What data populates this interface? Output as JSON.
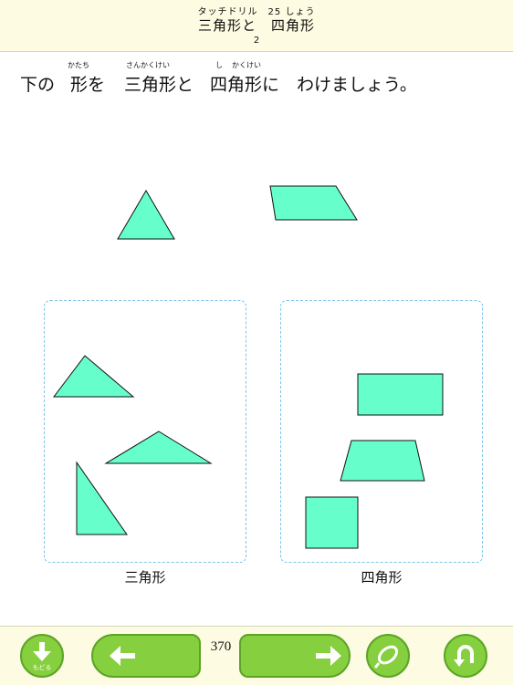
{
  "header": {
    "subtitle": "タッチドリル　25 しょう",
    "title": "三角形と　四角形",
    "page": "2"
  },
  "instruction": {
    "part1": "下の",
    "part2": "形を",
    "part3": "三角形と",
    "part4": "四角形に",
    "part5": "わけましょう。",
    "ruby_katachi": "かたち",
    "ruby_sankakukei": "さんかくけい",
    "ruby_shi": "し",
    "ruby_kakukei": "かくけい"
  },
  "boxes": {
    "triangle_label": "三角形",
    "quad_label": "四角形"
  },
  "footer": {
    "back_label": "もどる",
    "counter": "370"
  },
  "icons": {
    "back": "down-arrow-icon",
    "prev": "left-arrow-icon",
    "next": "right-arrow-icon",
    "pen": "pen-loop-icon",
    "undo": "undo-icon"
  },
  "colors": {
    "shape_fill": "#66ffcc",
    "button_green": "#86cf3e",
    "dash_blue": "#7cc4ea",
    "header_bg": "#fdfbe1"
  }
}
